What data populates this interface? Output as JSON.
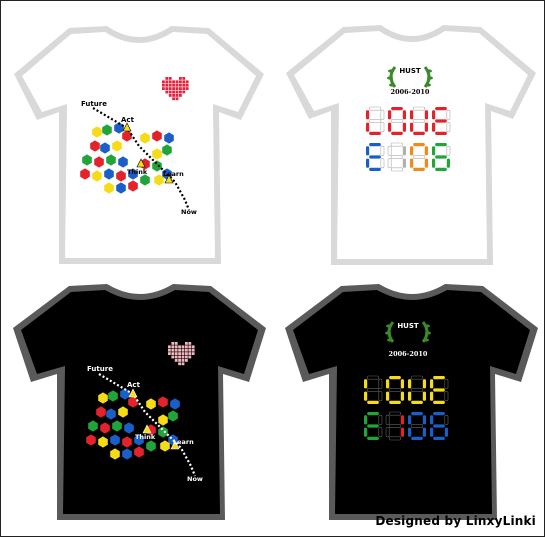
{
  "shirts": [
    {
      "name": "white-game-shirt",
      "body": "#ffffff",
      "outline": "#d9d9d9",
      "text": "#000000",
      "heart": "#e8203a",
      "dots": "#000000"
    },
    {
      "name": "white-love-shirt",
      "body": "#ffffff",
      "outline": "#d9d9d9",
      "text": "#000000"
    },
    {
      "name": "black-game-shirt",
      "body": "#000000",
      "outline": "#5a5a5a",
      "text": "#ffffff",
      "heart": "#f2b6bf",
      "dots": "#ffffff"
    },
    {
      "name": "black-love-shirt",
      "body": "#000000",
      "outline": "#5a5a5a",
      "text": "#ffffff"
    }
  ],
  "path_labels": {
    "future": "Future",
    "act": "Act",
    "think": "Think",
    "learn": "Learn",
    "now": "Now"
  },
  "seal": {
    "school": "HUST",
    "years": "2006-2010",
    "laurel": "#3a8a2a"
  },
  "hex_colors": {
    "red": "#e3232b",
    "yellow": "#f5dc18",
    "blue": "#1a5fc8",
    "green": "#21a53a"
  },
  "segment_colors_white": {
    "row1": "#e3232b",
    "row2": [
      "#1a5fc8",
      "#b0b0b0",
      "#f08a18",
      "#21a53a"
    ]
  },
  "segment_colors_black": {
    "row1": "#f5dc18",
    "row2": [
      "#21a53a",
      "#e3232b",
      "#1a5fc8",
      "#1a5fc8"
    ]
  },
  "credit": "Designed by LinxyLinki"
}
